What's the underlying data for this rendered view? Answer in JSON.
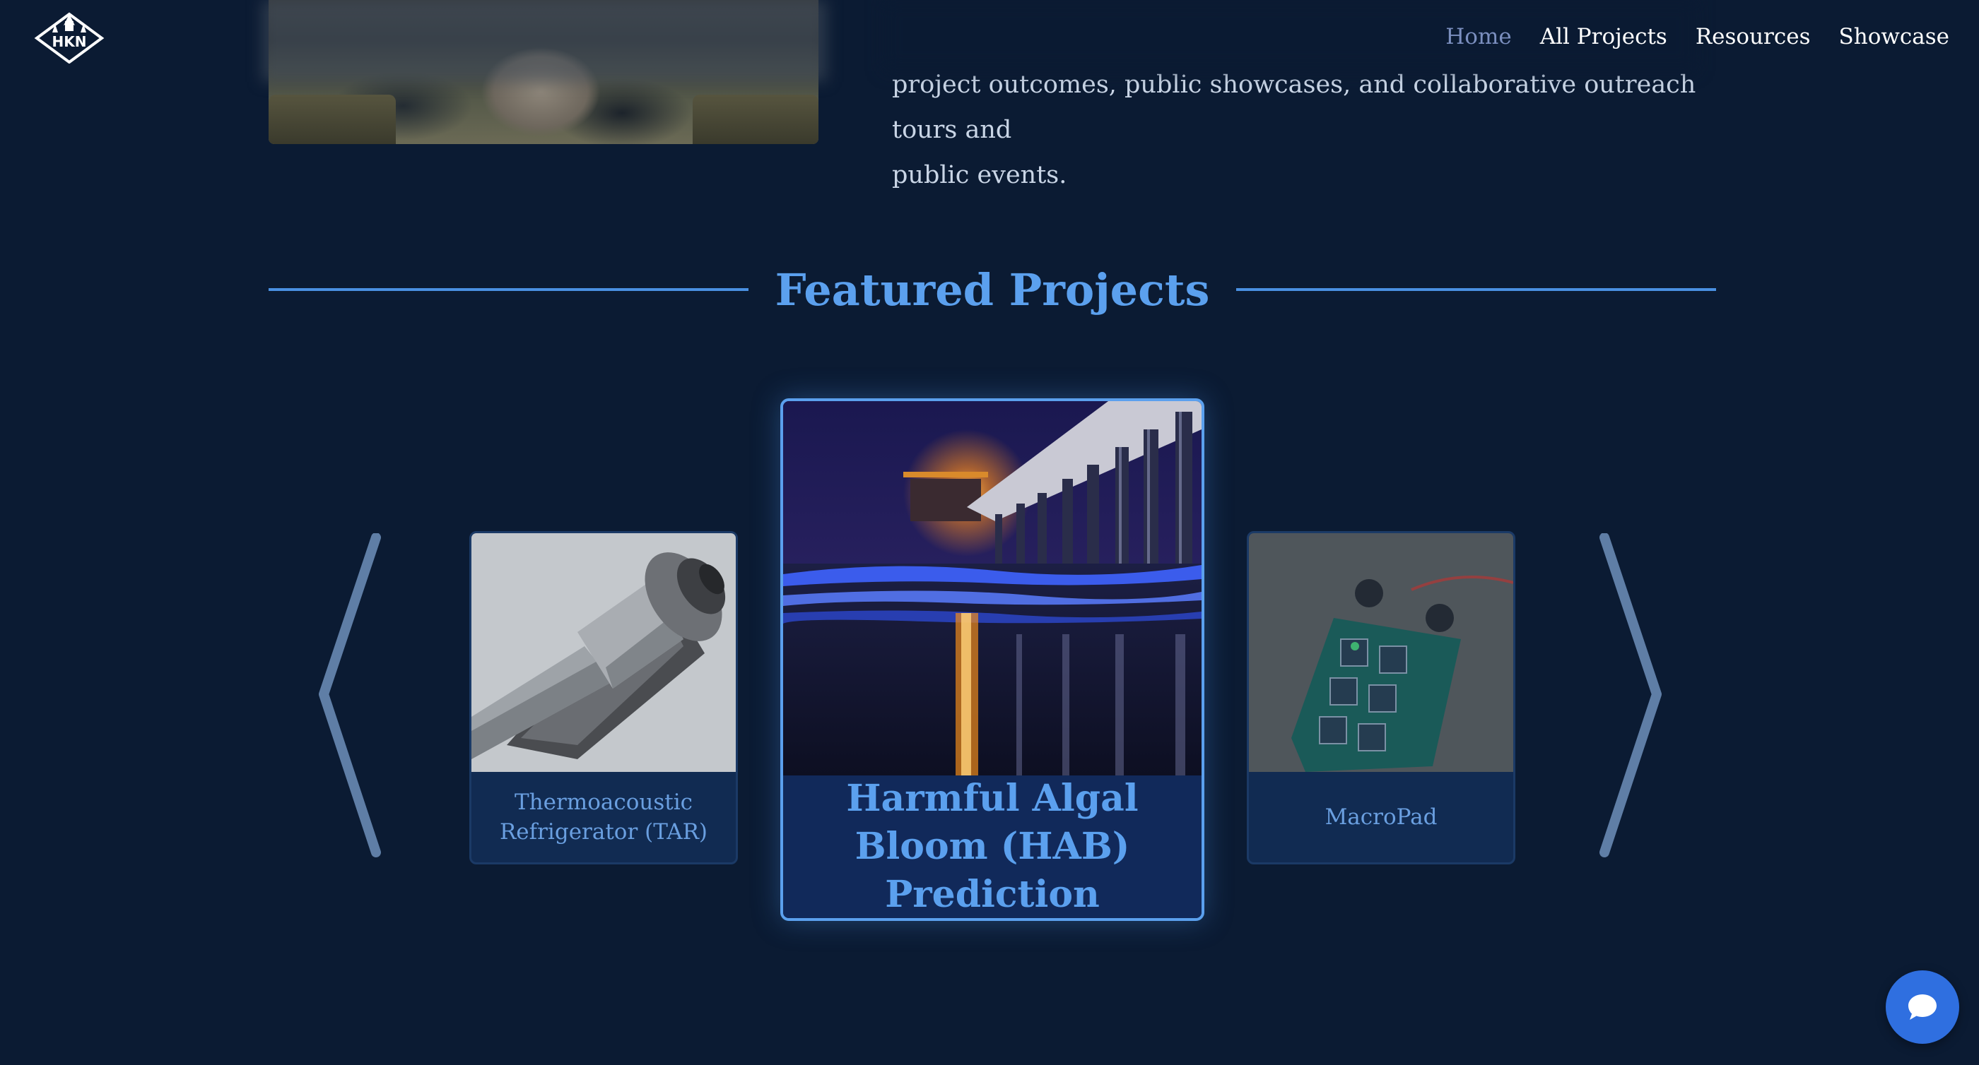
{
  "header": {
    "logo_icon": "hkn-logo-icon",
    "nav": [
      {
        "label": "Home",
        "active": true
      },
      {
        "label": "All Projects",
        "active": false
      },
      {
        "label": "Resources",
        "active": false
      },
      {
        "label": "Showcase",
        "active": false
      }
    ]
  },
  "intro": {
    "text_line1": "project outcomes, public showcases, and collaborative outreach tours and",
    "text_line2": "public events."
  },
  "featured": {
    "title": "Featured Projects",
    "prev_icon": "chevron-left-icon",
    "next_icon": "chevron-right-icon",
    "cards": [
      {
        "title": "Thermoacoustic Refrigerator (TAR)",
        "image": "thermoacoustic-refrigerator-render"
      },
      {
        "title": "Harmful Algal Bloom (HAB) Prediction",
        "image": "pier-bioluminescent-waves-night"
      },
      {
        "title": "MacroPad",
        "image": "macropad-circuit-board"
      }
    ]
  },
  "chat": {
    "icon": "chat-bubble-icon"
  },
  "colors": {
    "background": "#0b1b33",
    "accent": "#5ba0ee",
    "card": "#112b52",
    "chat_button": "#2f6fe0",
    "nav_active": "#7b8fbf"
  }
}
